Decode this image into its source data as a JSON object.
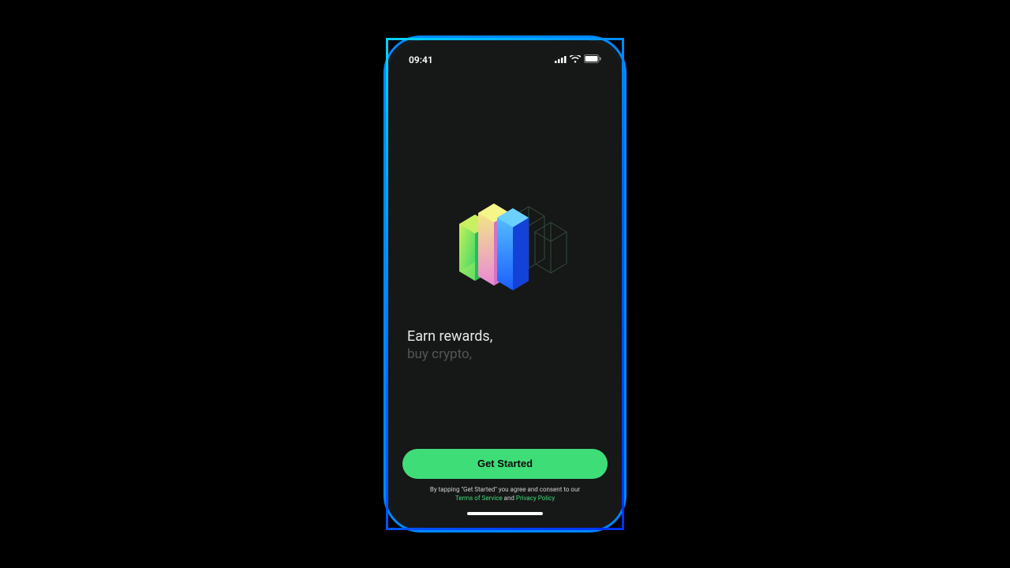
{
  "status": {
    "time": "09:41"
  },
  "headline": {
    "primary": "Earn rewards,",
    "secondary": "buy crypto,"
  },
  "cta": {
    "label": "Get Started"
  },
  "consent": {
    "prefix": "By tapping \"Get Started\" you agree and consent to our",
    "tos": "Terms of Service",
    "and": " and ",
    "privacy": "Privacy Policy"
  },
  "colors": {
    "accent": "#3fdd78"
  }
}
